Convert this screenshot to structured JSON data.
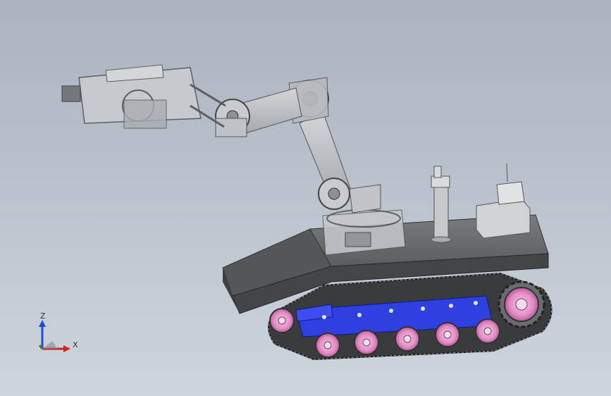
{
  "triad": {
    "z_label": "Z",
    "x_label": "X"
  },
  "colors": {
    "background_top": "#aab3c0",
    "background_bottom": "#cfd5dc",
    "hull": "#6f7073",
    "hull_dark": "#4a4b4e",
    "track": "#2e2f31",
    "frame_blue": "#2f3fe0",
    "wheel_pink": "#e98fc8",
    "arm_gray": "#b9bcc0",
    "axis_x": "#d32020",
    "axis_y": "#2b8a2b",
    "axis_z": "#1f4fd0"
  }
}
